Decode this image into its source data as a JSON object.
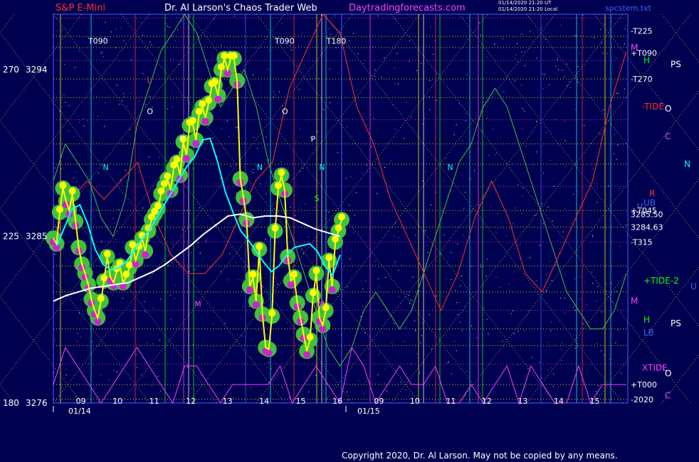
{
  "header": {
    "symbol": "S&P E-Mini",
    "title": "Dr. Al Larson's Chaos Trader Web",
    "site": "Daytradingforecasts.com",
    "stamp1": "01/14/2020 21:20 UT",
    "stamp2": "01/14/2020 21:20 Local",
    "file": "spcstem.txt"
  },
  "footer": {
    "copyright": "Copyright 2020, Dr. Al Larson. May not be copied by any means."
  },
  "colors": {
    "background": "#000050",
    "price": "#ffff00",
    "ma_fast": "#00ffff",
    "ma_slow": "#ffffff",
    "green_flux": "#40c040",
    "red_flux": "#ff3030",
    "magenta_flux": "#ff40ff"
  },
  "chart_data": {
    "type": "line",
    "title": "S&P E-Mini",
    "y_axis": {
      "range": [
        3276,
        3297
      ],
      "labels": [
        {
          "angle": "270",
          "price": "3294"
        },
        {
          "angle": "225",
          "price": "3285"
        },
        {
          "angle": "180",
          "price": "3276"
        }
      ]
    },
    "x_axis": {
      "dates": [
        "01/14",
        "01/15"
      ],
      "hours_day1": [
        "09",
        "10",
        "11",
        "12",
        "13",
        "14",
        "15",
        "16"
      ],
      "hours_day2": [
        "09",
        "10",
        "11",
        "12",
        "13",
        "14",
        "15"
      ]
    },
    "series": [
      {
        "name": "price",
        "values": [
          3284.9,
          3284.6,
          3286.3,
          3287.6,
          3286.9,
          3286.4,
          3287.3,
          3285.8,
          3284.4,
          3283.5,
          3283.0,
          3282.4,
          3281.6,
          3281.0,
          3280.6,
          3281.5,
          3282.6,
          3283.9,
          3282.8,
          3282.5,
          3283.1,
          3283.4,
          3282.5,
          3282.8,
          3283.3,
          3284.4,
          3283.7,
          3284.3,
          3284.9,
          3284.2,
          3285.3,
          3285.9,
          3286.2,
          3286.5,
          3287.3,
          3287.7,
          3288.1,
          3287.5,
          3288.7,
          3289.0,
          3288.3,
          3290.1,
          3289.4,
          3291.0,
          3291.1,
          3290.2,
          3291.6,
          3292.0,
          3291.4,
          3292.2,
          3293.1,
          3293.2,
          3292.6,
          3294.0,
          3294.6,
          3294.0,
          3294.6,
          3294.6,
          3293.4,
          3288.1,
          3287.1,
          3285.9,
          3282.3,
          3282.8,
          3281.5,
          3284.3,
          3280.8,
          3279.0,
          3278.9,
          3280.7,
          3285.3,
          3287.6,
          3288.3,
          3287.5,
          3283.9,
          3282.6,
          3282.8,
          3281.4,
          3280.6,
          3279.7,
          3278.8,
          3279.4,
          3281.8,
          3283.0,
          3280.6,
          3280.2,
          3281.0,
          3283.7,
          3282.3,
          3284.7,
          3285.3,
          3285.9
        ]
      },
      {
        "name": "fast average",
        "values": [
          3284.5,
          3285.5,
          3286.5,
          3286.7,
          3285.7,
          3284.3,
          3283.5,
          3283.2,
          3283.3,
          3283.6,
          3284.2,
          3284.8,
          3285.3,
          3286.0,
          3286.7,
          3287.4,
          3288.1,
          3288.8,
          3289.3,
          3290.2,
          3290.3,
          3289.0,
          3287.4,
          3286.3,
          3285.3,
          3284.8,
          3284.2,
          3283.6,
          3283.1,
          3283.4,
          3284.0,
          3284.4,
          3284.5,
          3284.6,
          3284.2,
          3283.4,
          3282.9,
          3284.0
        ]
      },
      {
        "name": "slow average",
        "values": [
          3281.5,
          3281.8,
          3282.0,
          3282.2,
          3282.3,
          3282.4,
          3282.5,
          3282.8,
          3283.1,
          3283.5,
          3284.0,
          3284.5,
          3285.1,
          3285.6,
          3286.1,
          3286.2,
          3286.0,
          3286.1,
          3286.1,
          3286.0,
          3285.7,
          3285.4,
          3285.2,
          3285.0
        ]
      },
      {
        "name": "electric flux 1",
        "values": [
          3288,
          3290,
          3289,
          3288,
          3286,
          3285,
          3287,
          3291,
          3293,
          3295,
          3296,
          3297,
          3296,
          3294,
          3292,
          3293,
          3294,
          3292,
          3289,
          3287,
          3285,
          3283,
          3281,
          3279,
          3278,
          3279,
          3281,
          3282,
          3281,
          3280,
          3281,
          3283,
          3285,
          3287,
          3289,
          3290,
          3292,
          3293,
          3292,
          3290,
          3288,
          3286,
          3284,
          3282,
          3281,
          3280,
          3280,
          3281,
          3283
        ]
      },
      {
        "name": "electric flux 2",
        "values": [
          3285,
          3287,
          3288,
          3287,
          3288,
          3289,
          3286,
          3284,
          3283,
          3283,
          3284,
          3286,
          3288,
          3289,
          3293,
          3295,
          3297,
          3296,
          3292,
          3290,
          3287,
          3285,
          3283,
          3281,
          3283,
          3286,
          3288,
          3286,
          3283,
          3282,
          3284,
          3286,
          3288,
          3292,
          3295
        ]
      },
      {
        "name": "electric flux 3",
        "values": [
          3277,
          3279,
          3278,
          3277,
          3276,
          3277,
          3278,
          3279,
          3278,
          3277,
          3276,
          3278,
          3278,
          3277,
          3276,
          3277,
          3277,
          3277,
          3277,
          3278,
          3276,
          3277,
          3278,
          3277,
          3276,
          3279,
          3278,
          3276,
          3277,
          3278,
          3277,
          3277,
          3278,
          3276,
          3276,
          3277,
          3276,
          3277,
          3278,
          3276,
          3278,
          3277,
          3276,
          3276,
          3278,
          3276,
          3277,
          3277,
          3277
        ]
      }
    ],
    "right_levels": [
      {
        "label": "-T225",
        "price": 3296.1
      },
      {
        "label": "+T090",
        "price": 3294.9
      },
      {
        "label": "-T270",
        "price": 3293.5
      },
      {
        "label": "+T045",
        "price": 3286.4
      },
      {
        "label": "3285.50",
        "price": 3286.2
      },
      {
        "label": "3284.63",
        "price": 3285.5
      },
      {
        "label": "-T315",
        "price": 3284.7
      },
      {
        "label": "+T000",
        "price": 3277.0
      },
      {
        "label": "-2020",
        "price": 3276.2
      }
    ],
    "side_labels": [
      {
        "text": "M",
        "color": "#ff40ff",
        "price": 3295.2
      },
      {
        "text": "H",
        "color": "#00ff00",
        "price": 3294.5
      },
      {
        "text": "PS",
        "color": "#ffffff",
        "price": 3294.3
      },
      {
        "text": "-TIDE",
        "color": "#ff3030",
        "price": 3292.0
      },
      {
        "text": "O",
        "color": "#ffffff",
        "price": 3291.9
      },
      {
        "text": "C",
        "color": "#ff40ff",
        "price": 3290.4
      },
      {
        "text": "N",
        "color": "#00ffff",
        "price": 3288.9
      },
      {
        "text": "R",
        "color": "#ff3030",
        "price": 3287.3
      },
      {
        "text": "UB",
        "color": "#4060ff",
        "price": 3286.8
      },
      {
        "text": "V",
        "color": "#4060ff",
        "price": 3286.6
      },
      {
        "text": "+TIDE-2",
        "color": "#00ff00",
        "price": 3282.6
      },
      {
        "text": "U",
        "color": "#4060ff",
        "price": 3282.3
      },
      {
        "text": "M",
        "color": "#ff40ff",
        "price": 3281.5
      },
      {
        "text": "H",
        "color": "#00ff00",
        "price": 3280.5
      },
      {
        "text": "PS",
        "color": "#ffffff",
        "price": 3280.3
      },
      {
        "text": "LB",
        "color": "#4060ff",
        "price": 3279.8
      },
      {
        "text": "XTIDE",
        "color": "#ff40ff",
        "price": 3277.9
      },
      {
        "text": "O",
        "color": "#ffffff",
        "price": 3277.6
      },
      {
        "text": "C",
        "color": "#ff40ff",
        "price": 3276.4
      }
    ],
    "markers": [
      {
        "text": "T090",
        "color": "#ffffff",
        "hour": 9.2,
        "price": 3295.4
      },
      {
        "text": "T180",
        "color": "#ffffff",
        "hour": 15.7,
        "price": 3295.4
      },
      {
        "text": "T090",
        "color": "#ffffff",
        "hour": 30.1,
        "price": 3295.4
      },
      {
        "text": "O",
        "color": "#ffffff",
        "hour": 10.8,
        "price": 3291.6
      },
      {
        "text": "O",
        "color": "#ffffff",
        "hour": 30.3,
        "price": 3291.6
      },
      {
        "text": "P",
        "color": "#ffffff",
        "hour": 11.7,
        "price": 3290.1
      },
      {
        "text": "P",
        "color": "#ffffff",
        "hour": 31.1,
        "price": 3290.1
      },
      {
        "text": "N",
        "color": "#00ffff",
        "hour": 9.6,
        "price": 3288.6
      },
      {
        "text": "N",
        "color": "#00ffff",
        "hour": 15.5,
        "price": 3288.6
      },
      {
        "text": "N",
        "color": "#00ffff",
        "hour": 29.6,
        "price": 3288.6
      },
      {
        "text": "N",
        "color": "#00ffff",
        "hour": 34.9,
        "price": 3288.6
      },
      {
        "text": "M",
        "color": "#ff40ff",
        "hour": 12.1,
        "price": 3281.2
      },
      {
        "text": "M",
        "color": "#ff40ff",
        "hour": 31.3,
        "price": 3281.2
      },
      {
        "text": "S",
        "color": "#00ff00",
        "hour": 31.2,
        "price": 3286.9
      },
      {
        "text": "L",
        "color": "#ff3030",
        "hour": 10.8,
        "price": 3293.3
      }
    ],
    "grid": false,
    "legend": "right"
  }
}
